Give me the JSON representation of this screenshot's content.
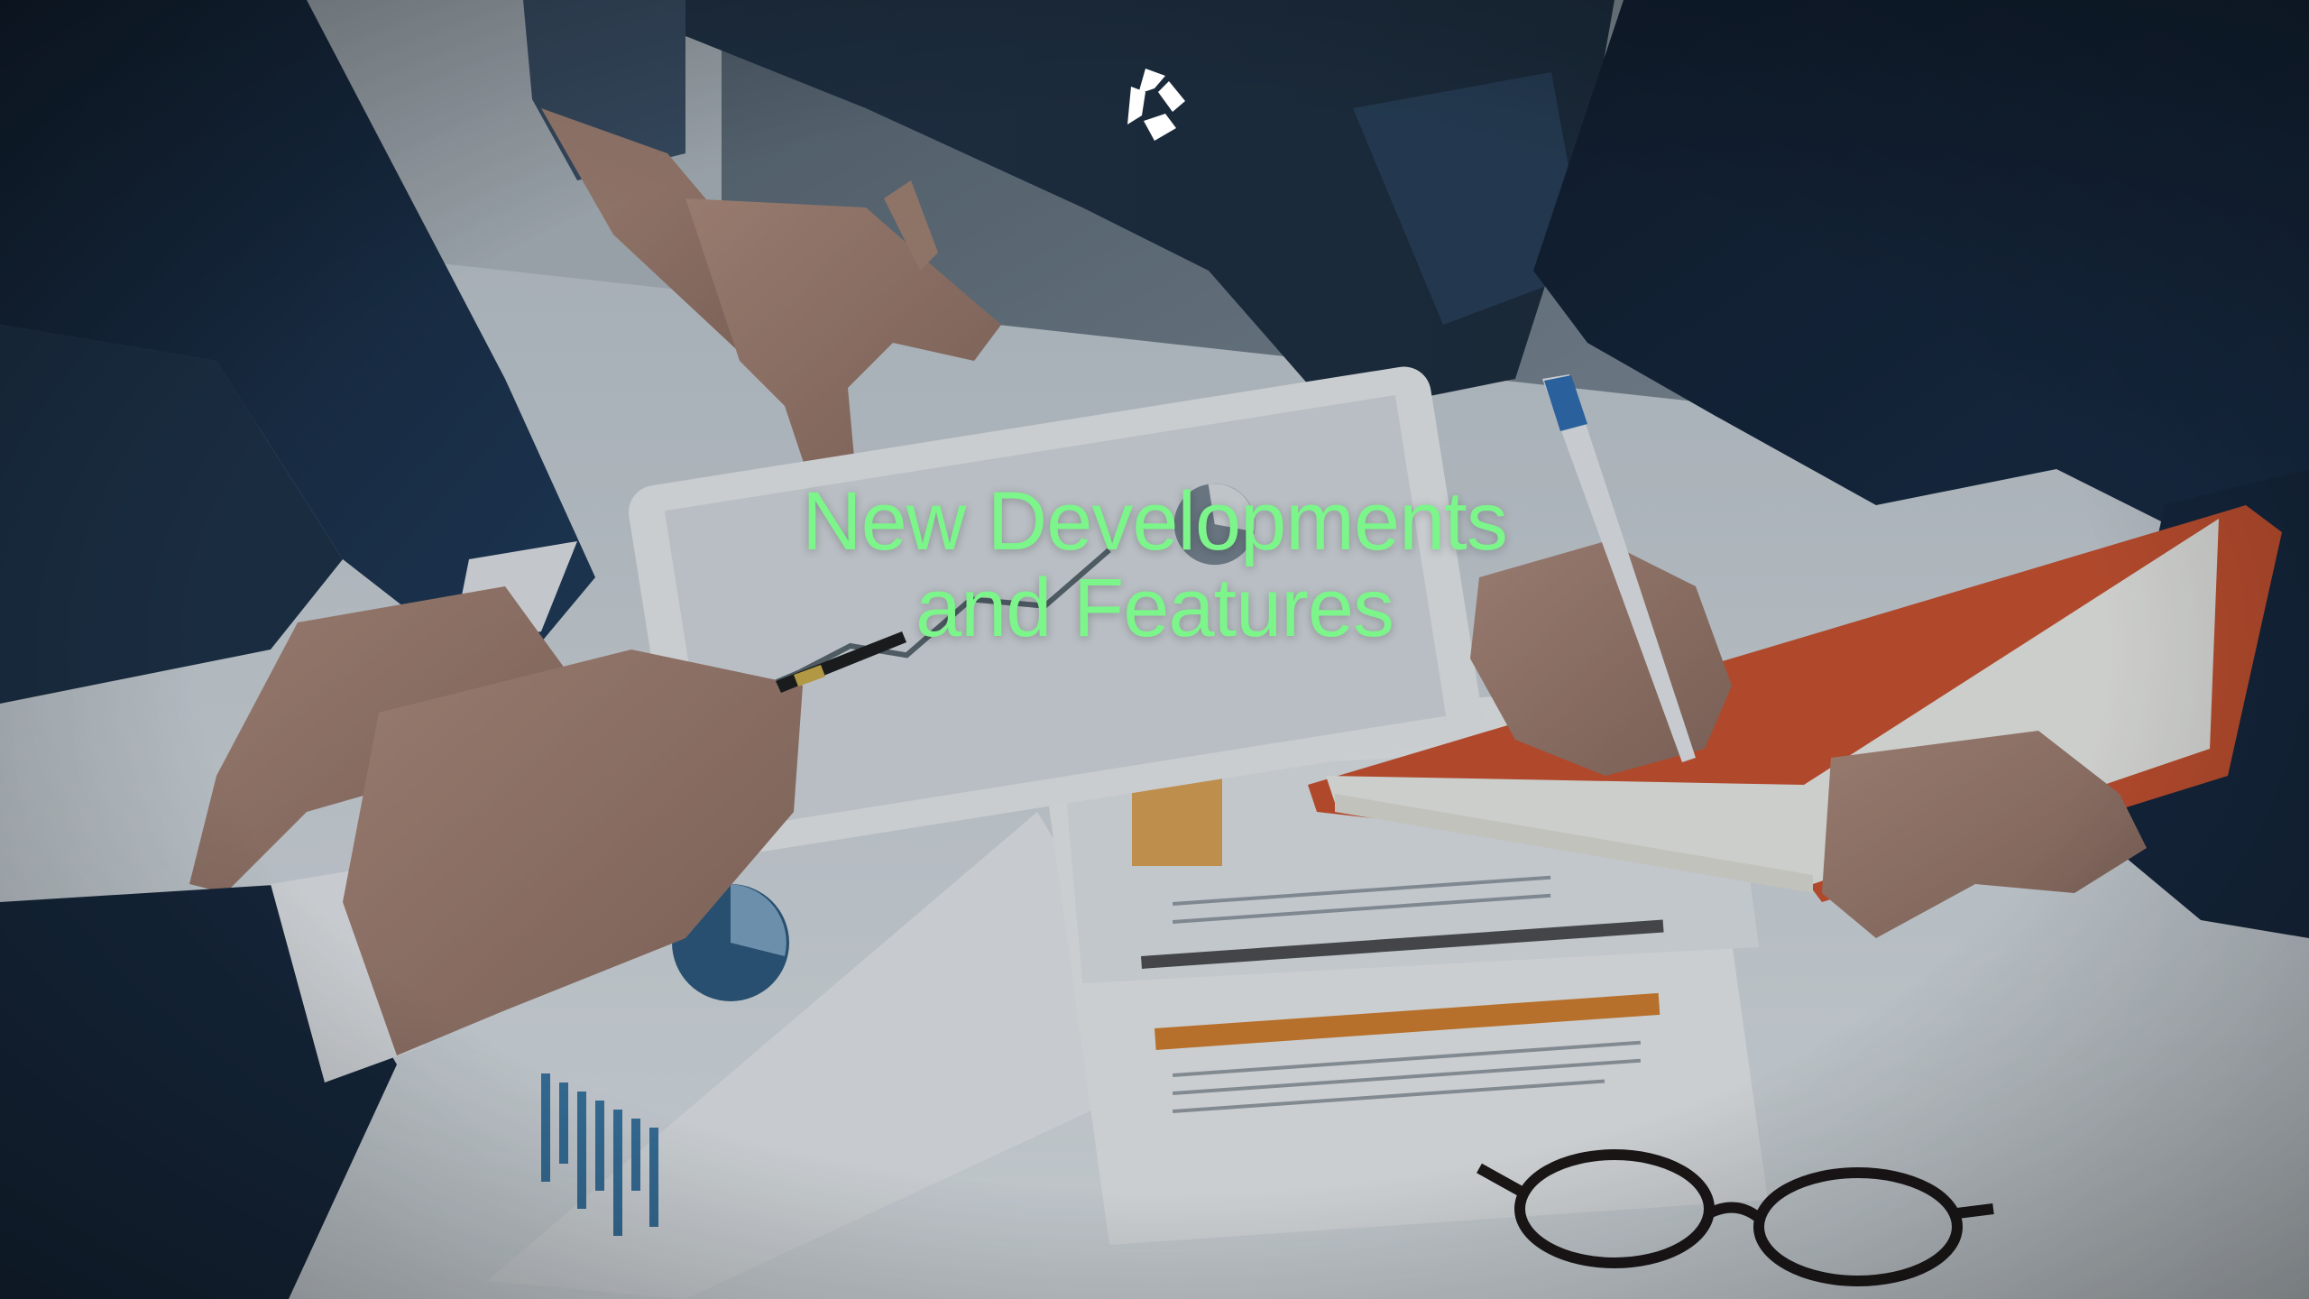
{
  "slide": {
    "title_line1": "New Developments",
    "title_line2": "and Features"
  },
  "brand": {
    "logo_icon": "brand-logo-icon",
    "logo_color": "#ffffff"
  },
  "colors": {
    "headline": "#7cf58a",
    "overlay": "#14202e",
    "table": "#dfe4e8",
    "sleeve_dark": "#16263d"
  },
  "background": {
    "icon": "meeting-photo"
  }
}
